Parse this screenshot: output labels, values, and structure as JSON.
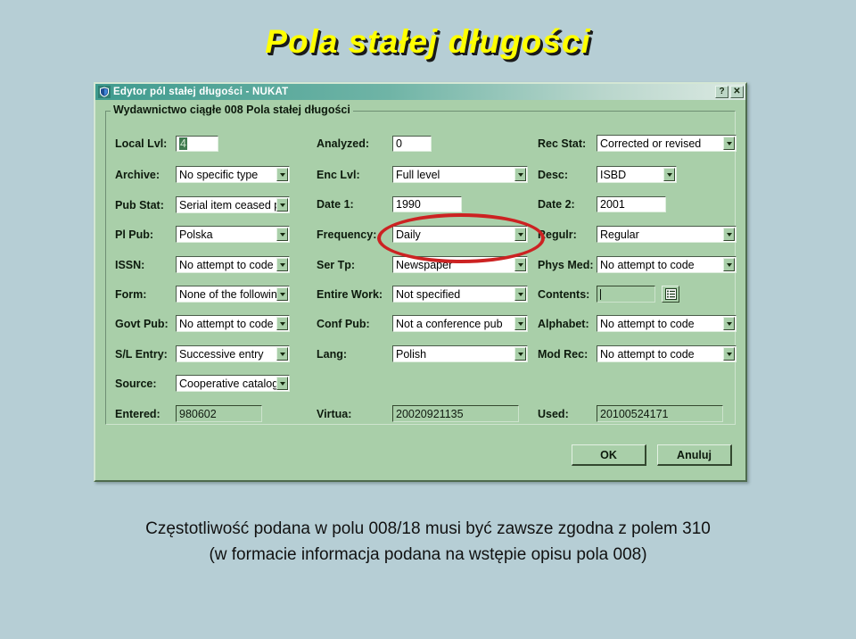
{
  "slide": {
    "title": "Pola stałej długości",
    "caption_line1": "Częstotliwość podana w polu 008/18 musi być zawsze zgodna z polem 310",
    "caption_line2": "(w formacie informacja podana na wstępie opisu pola 008)"
  },
  "dialog": {
    "titlebar": {
      "title": "Edytor pól stałej długości - NUKAT",
      "help_button": "?",
      "close_button": "✕"
    },
    "group_legend": "Wydawnictwo ciągłe 008 Pola stałej długości",
    "fields": {
      "local_lvl": {
        "label": "Local Lvl:",
        "value": "4"
      },
      "analyzed": {
        "label": "Analyzed:",
        "value": "0"
      },
      "rec_stat": {
        "label": "Rec Stat:",
        "value": "Corrected or revised"
      },
      "archive": {
        "label": "Archive:",
        "value": "No specific type"
      },
      "enc_lvl": {
        "label": "Enc Lvl:",
        "value": "Full level"
      },
      "desc": {
        "label": "Desc:",
        "value": "ISBD"
      },
      "pub_stat": {
        "label": "Pub Stat:",
        "value": "Serial item ceased pub"
      },
      "date_1": {
        "label": "Date 1:",
        "value": "1990"
      },
      "date_2": {
        "label": "Date 2:",
        "value": "2001"
      },
      "pl_pub": {
        "label": "Pl Pub:",
        "value": "Polska"
      },
      "frequency": {
        "label": "Frequency:",
        "value": "Daily"
      },
      "regulr": {
        "label": "Regulr:",
        "value": "Regular"
      },
      "issn": {
        "label": "ISSN:",
        "value": "No attempt to code"
      },
      "ser_tp": {
        "label": "Ser Tp:",
        "value": "Newspaper"
      },
      "phys_med": {
        "label": "Phys Med:",
        "value": "No attempt to code"
      },
      "form": {
        "label": "Form:",
        "value": "None of the following"
      },
      "entire_work": {
        "label": "Entire Work:",
        "value": "Not specified"
      },
      "contents": {
        "label": "Contents:",
        "value": ""
      },
      "govt_pub": {
        "label": "Govt Pub:",
        "value": "No attempt to code"
      },
      "conf_pub": {
        "label": "Conf Pub:",
        "value": "Not a conference pub"
      },
      "alphabet": {
        "label": "Alphabet:",
        "value": "No attempt to code"
      },
      "sl_entry": {
        "label": "S/L Entry:",
        "value": "Successive entry"
      },
      "lang": {
        "label": "Lang:",
        "value": "Polish"
      },
      "mod_rec": {
        "label": "Mod Rec:",
        "value": "No attempt to code"
      },
      "source": {
        "label": "Source:",
        "value": "Cooperative cataloging"
      },
      "entered": {
        "label": "Entered:",
        "value": "980602"
      },
      "virtua": {
        "label": "Virtua:",
        "value": "20020921135"
      },
      "used": {
        "label": "Used:",
        "value": "20100524171"
      }
    },
    "buttons": {
      "ok": "OK",
      "cancel": "Anuluj"
    }
  },
  "annotation": {
    "highlight_target": "frequency"
  },
  "colors": {
    "slide_background": "#b6ced5",
    "title_text": "#ffff00",
    "dialog_face": "#a9cfa9",
    "titlebar_gradient_start": "#3f9b8f",
    "annotation_red": "#cc2222"
  }
}
